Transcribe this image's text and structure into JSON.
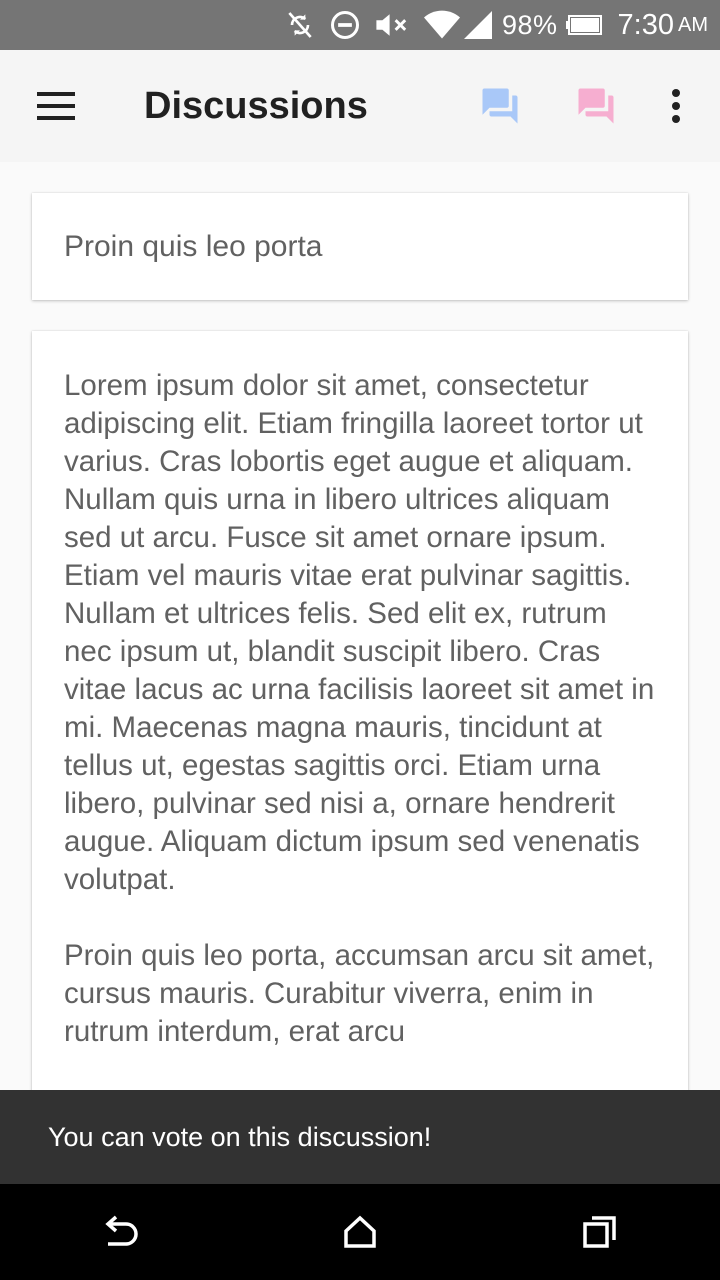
{
  "status_bar": {
    "battery_percent": "98%",
    "time": "7:30",
    "ampm": "AM",
    "icons": [
      "sync-off-icon",
      "do-not-disturb-icon",
      "volume-mute-icon",
      "wifi-icon",
      "cell-signal-icon",
      "battery-icon"
    ]
  },
  "app_bar": {
    "title": "Discussions",
    "menu_icon": "menu-icon",
    "actions": [
      {
        "name": "forum-icon",
        "color": "#a9c8f8"
      },
      {
        "name": "forum-icon",
        "color": "#f6aed0"
      }
    ],
    "overflow_icon": "more-vert-icon"
  },
  "discussion": {
    "title": "Proin quis leo porta",
    "paragraphs": [
      "Lorem ipsum dolor sit amet, consectetur adipiscing elit. Etiam fringilla laoreet tortor ut varius. Cras lobortis eget augue et aliquam. Nullam quis urna in libero ultrices aliquam sed ut arcu. Fusce sit amet ornare ipsum. Etiam vel mauris vitae erat pulvinar sagittis. Nullam et ultrices felis. Sed elit ex, rutrum nec ipsum ut, blandit suscipit libero. Cras vitae lacus ac urna facilisis laoreet sit amet in mi. Maecenas magna mauris, tincidunt at tellus ut, egestas sagittis orci. Etiam urna libero, pulvinar sed nisi a, ornare hendrerit augue. Aliquam dictum ipsum sed venenatis volutpat.",
      "Proin quis leo porta, accumsan arcu sit amet, cursus mauris. Curabitur viverra, enim in rutrum interdum, erat arcu"
    ]
  },
  "snackbar": {
    "message": "You can vote on this discussion!"
  },
  "nav_bar": {
    "icons": [
      "back-icon",
      "home-icon",
      "recents-icon"
    ]
  }
}
